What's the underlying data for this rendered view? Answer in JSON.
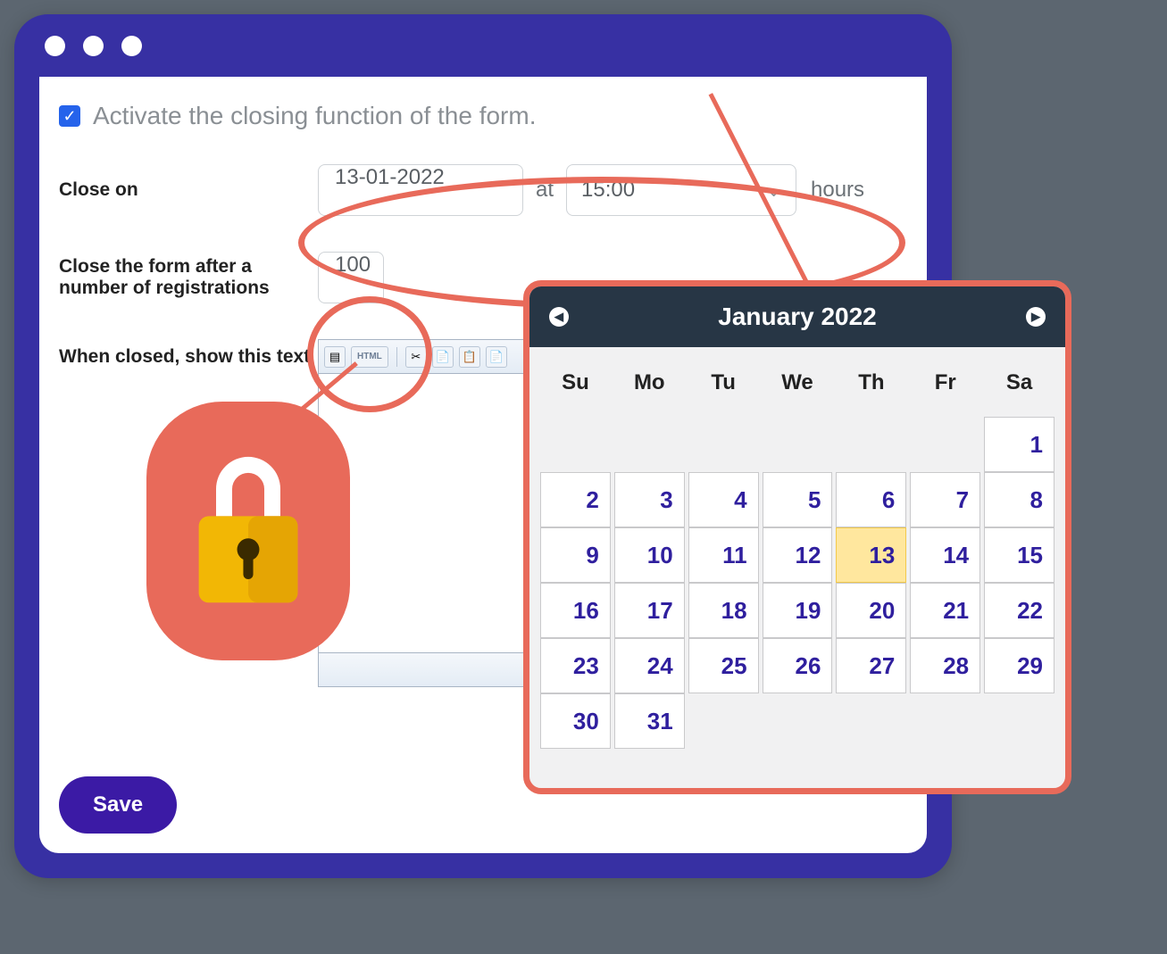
{
  "form": {
    "activate_label": "Activate the closing function of the form.",
    "activate_checked": true,
    "close_on_label": "Close on",
    "close_date": "13-01-2022",
    "at_word": "at",
    "close_time": "15:00",
    "hours_word": "hours",
    "registrations_label": "Close the form after a number of registrations",
    "registrations_value": "100",
    "closed_text_label": "When closed, show this text",
    "save_label": "Save"
  },
  "editor_toolbar": {
    "source": "▤",
    "html": "HTML",
    "cut": "✂",
    "copy": "📄",
    "paste_text": "📋",
    "paste_word": "📄"
  },
  "calendar": {
    "title": "January 2022",
    "daynames": [
      "Su",
      "Mo",
      "Tu",
      "We",
      "Th",
      "Fr",
      "Sa"
    ],
    "weeks": [
      [
        null,
        null,
        null,
        null,
        null,
        null,
        1
      ],
      [
        2,
        3,
        4,
        5,
        6,
        7,
        8
      ],
      [
        9,
        10,
        11,
        12,
        13,
        14,
        15
      ],
      [
        16,
        17,
        18,
        19,
        20,
        21,
        22
      ],
      [
        23,
        24,
        25,
        26,
        27,
        28,
        29
      ],
      [
        30,
        31,
        null,
        null,
        null,
        null,
        null
      ]
    ],
    "selected_day": 13
  }
}
